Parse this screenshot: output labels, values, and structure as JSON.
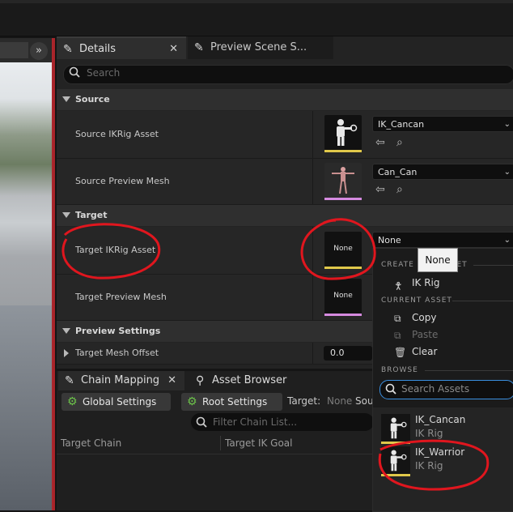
{
  "tabs": {
    "details": "Details",
    "preview_scene": "Preview Scene S..."
  },
  "search": {
    "placeholder": "Search"
  },
  "sections": {
    "source": "Source",
    "target": "Target",
    "preview_settings": "Preview Settings"
  },
  "source": {
    "ikrig_label": "Source IKRig Asset",
    "ikrig_value": "IK_Cancan",
    "mesh_label": "Source Preview Mesh",
    "mesh_value": "Can_Can"
  },
  "target": {
    "ikrig_label": "Target IKRig Asset",
    "ikrig_value": "None",
    "ikrig_thumb": "None",
    "mesh_label": "Target Preview Mesh",
    "mesh_thumb": "None"
  },
  "preview_settings": {
    "offset_label": "Target Mesh Offset",
    "offset_value": "0.0"
  },
  "tooltip": "None",
  "dropdown": {
    "create_header": "CREATE NEW ASSET",
    "create_item": "IK Rig",
    "current_header": "CURRENT ASSET",
    "copy": "Copy",
    "paste": "Paste",
    "clear": "Clear",
    "browse_header": "BROWSE",
    "search_placeholder": "Search Assets",
    "assets": [
      {
        "name": "IK_Cancan",
        "type": "IK Rig"
      },
      {
        "name": "IK_Warrior",
        "type": "IK Rig"
      }
    ]
  },
  "bottom": {
    "tab_chain": "Chain Mapping",
    "tab_asset": "Asset Browser",
    "global_settings": "Global Settings",
    "root_settings": "Root Settings",
    "target_label": "Target:",
    "target_value": "None",
    "source_cut": "Sou",
    "filter_placeholder": "Filter Chain List...",
    "col_target_chain": "Target Chain",
    "col_target_goal": "Target IK Goal"
  },
  "colors": {
    "accent_yellow": "#e0c84a",
    "accent_pink": "#d58adf",
    "annotation_red": "#e0161e",
    "search_focus": "#3a8fe0"
  },
  "icons": [
    "details-pencil-icon",
    "preview-scene-icon",
    "search-icon",
    "ikrig-figure-icon",
    "browse-arrow-icon",
    "find-asset-icon",
    "gear-icon",
    "copy-icon",
    "paste-icon",
    "trash-icon",
    "expand-chevron-icon"
  ]
}
